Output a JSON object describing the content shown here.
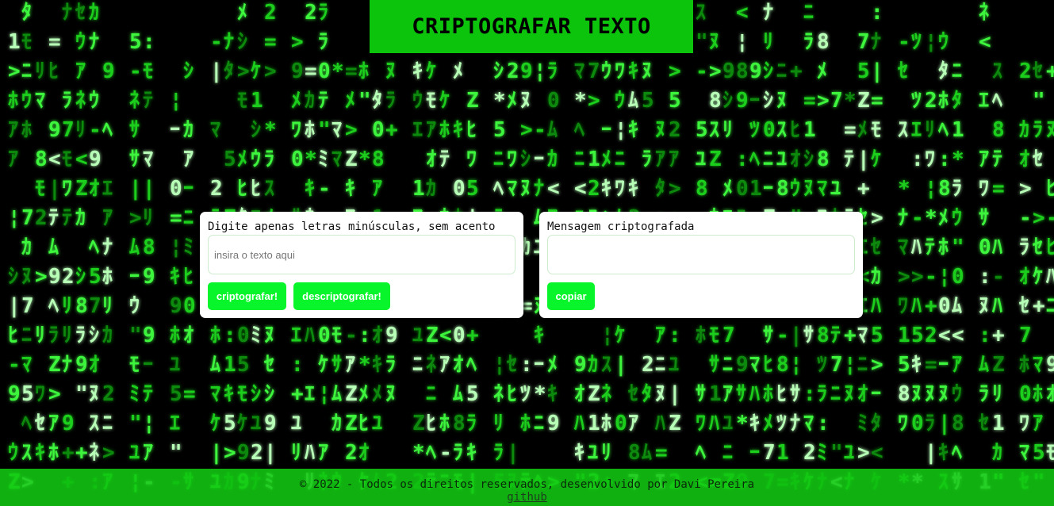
{
  "header": {
    "title": "CRIPTOGRAFAR TEXTO"
  },
  "encrypt_card": {
    "label": "Digite apenas letras minúsculas, sem acento",
    "input_placeholder": "insira o texto aqui",
    "input_value": "",
    "encrypt_button": "criptografar!",
    "decrypt_button": "descriptografar!"
  },
  "result_card": {
    "label": "Mensagem criptografada",
    "output_value": "",
    "copy_button": "copiar"
  },
  "footer": {
    "copyright": "© 2022 - Todos os direitos reservados, desenvolvido por Davi Pereira",
    "link_label": "github"
  },
  "colors": {
    "header_bg": "#0bc40b",
    "button_bg": "#08f52b",
    "footer_bg": "#12c812",
    "rain_green": "#2cf52c"
  },
  "background": {
    "image": "matrix-code-rain"
  }
}
